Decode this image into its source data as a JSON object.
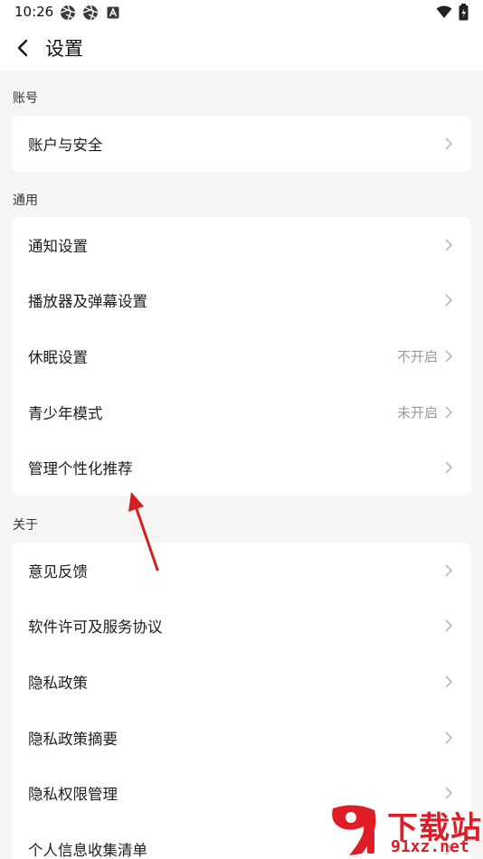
{
  "status_bar": {
    "time": "10:26",
    "icons": [
      "aperture-icon",
      "aperture-icon",
      "notification-a-icon"
    ],
    "right_icons": [
      "wifi-icon",
      "battery-icon"
    ]
  },
  "header": {
    "title": "设置"
  },
  "sections": [
    {
      "label": "账号",
      "items": [
        {
          "label": "账户与安全",
          "value": ""
        }
      ]
    },
    {
      "label": "通用",
      "items": [
        {
          "label": "通知设置",
          "value": ""
        },
        {
          "label": "播放器及弹幕设置",
          "value": ""
        },
        {
          "label": "休眠设置",
          "value": "不开启"
        },
        {
          "label": "青少年模式",
          "value": "未开启"
        },
        {
          "label": "管理个性化推荐",
          "value": ""
        }
      ]
    },
    {
      "label": "关于",
      "items": [
        {
          "label": "意见反馈",
          "value": ""
        },
        {
          "label": "软件许可及服务协议",
          "value": ""
        },
        {
          "label": "隐私政策",
          "value": ""
        },
        {
          "label": "隐私政策摘要",
          "value": ""
        },
        {
          "label": "隐私权限管理",
          "value": ""
        },
        {
          "label": "个人信息收集清单",
          "value": ""
        }
      ]
    }
  ],
  "watermark": {
    "title": "下载站",
    "domain": "91xz.net"
  },
  "colors": {
    "page_bg": "#f5f5f3",
    "card_bg": "#ffffff",
    "value_text": "#9a9a9a",
    "annotation_arrow": "#d42020",
    "watermark": "#e01d26"
  }
}
